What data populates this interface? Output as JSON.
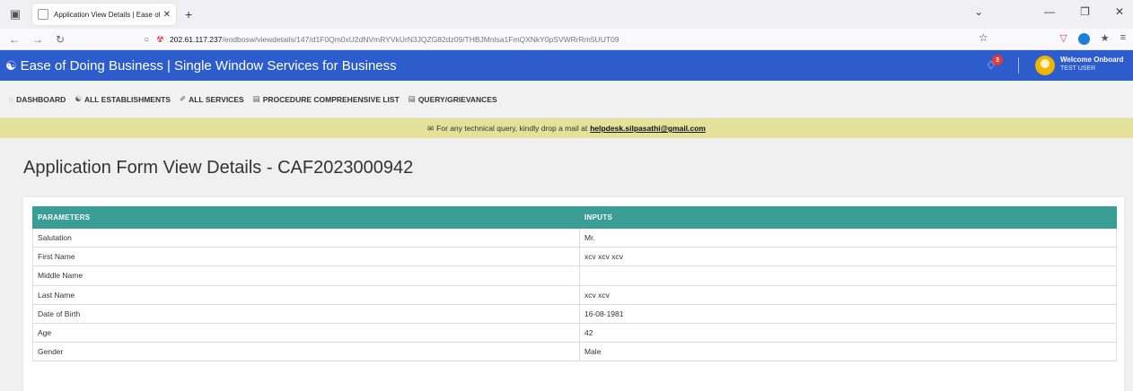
{
  "browser": {
    "tab_title": "Application View Details | Ease of d",
    "new_tab": "+",
    "url_host": "202.61.117.237",
    "url_path": "/eodbosw/viewdetails/147/d1F0Qm0xU2dNVmRYVkUrN3JQZG82dz09/THBJMnlsa1FmQXNkY0pSVWRrRm5UUT09"
  },
  "header": {
    "brand": "Ease of Doing Business | Single Window Services for Business",
    "notification_count": "3",
    "welcome": "Welcome Onboard",
    "user": "TEST USER",
    "brand_color": "#2d5ccc"
  },
  "nav": {
    "items": [
      {
        "label": "DASHBOARD",
        "icon": "dashboard-icon"
      },
      {
        "label": "ALL ESTABLISHMENTS",
        "icon": "building-icon"
      },
      {
        "label": "ALL SERVICES",
        "icon": "wrench-icon"
      },
      {
        "label": "PROCEDURE COMPREHENSIVE LIST",
        "icon": "list-icon"
      },
      {
        "label": "QUERY/GRIEVANCES",
        "icon": "list-icon"
      }
    ]
  },
  "notice": {
    "text": "For any technical query, kindly drop a mail at",
    "email": "helpdesk.silpasathi@gmail.com"
  },
  "page": {
    "title": "Application Form View Details - CAF2023000942"
  },
  "table": {
    "headers": [
      "PARAMETERS",
      "INPUTS"
    ],
    "header_color": "#3a9e96",
    "rows": [
      {
        "param": "Salutation",
        "input": "Mr."
      },
      {
        "param": "First Name",
        "input": "xcv xcv xcv"
      },
      {
        "param": "Middle Name",
        "input": ""
      },
      {
        "param": "Last Name",
        "input": "xcv xcv"
      },
      {
        "param": "Date of Birth",
        "input": "16-08-1981"
      },
      {
        "param": "Age",
        "input": "42"
      },
      {
        "param": "Gender",
        "input": "Male"
      }
    ]
  }
}
